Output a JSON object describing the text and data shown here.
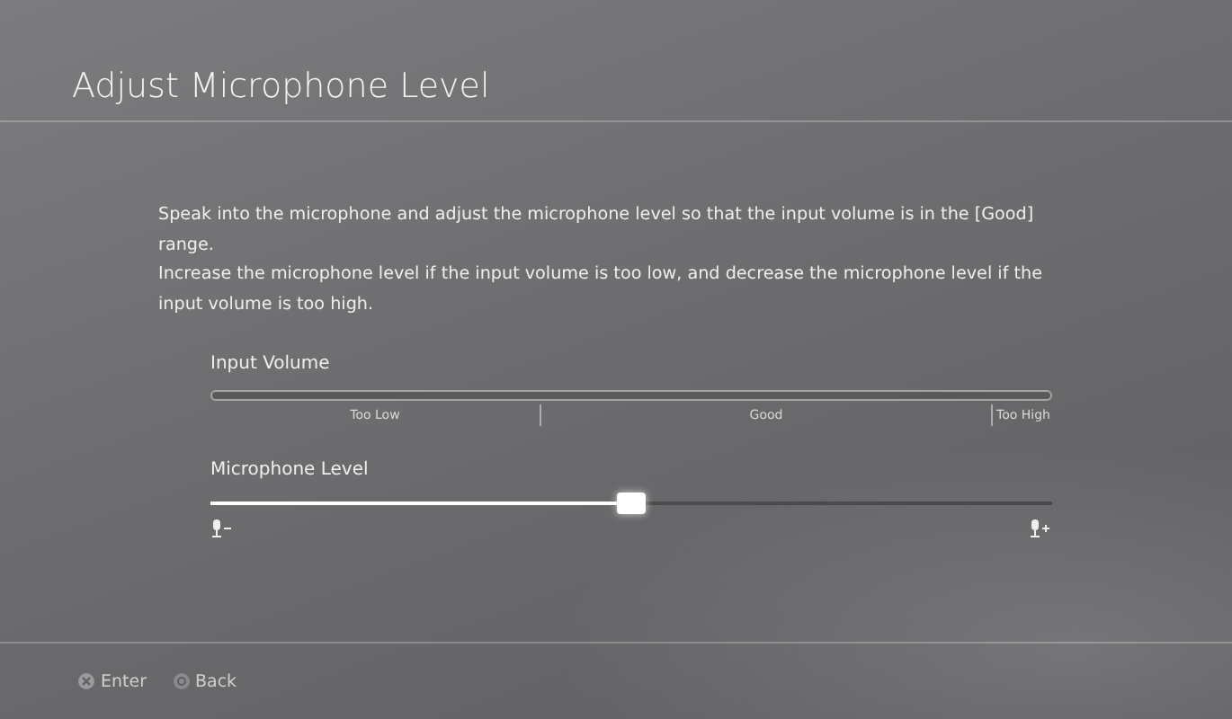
{
  "title": "Adjust Microphone Level",
  "instructions": [
    "Speak into the microphone and adjust the microphone level so that the input volume is in the [Good] range.",
    "Increase the microphone level if the input volume is too low, and decrease the microphone level if the input volume is too high."
  ],
  "input_volume": {
    "label": "Input Volume",
    "ranges": [
      "Too Low",
      "Good",
      "Too High"
    ]
  },
  "microphone_level": {
    "label": "Microphone Level",
    "level": 0.5
  },
  "footer_buttons": [
    {
      "kind": "cross",
      "label": "Enter"
    },
    {
      "kind": "circle",
      "label": "Back"
    }
  ]
}
